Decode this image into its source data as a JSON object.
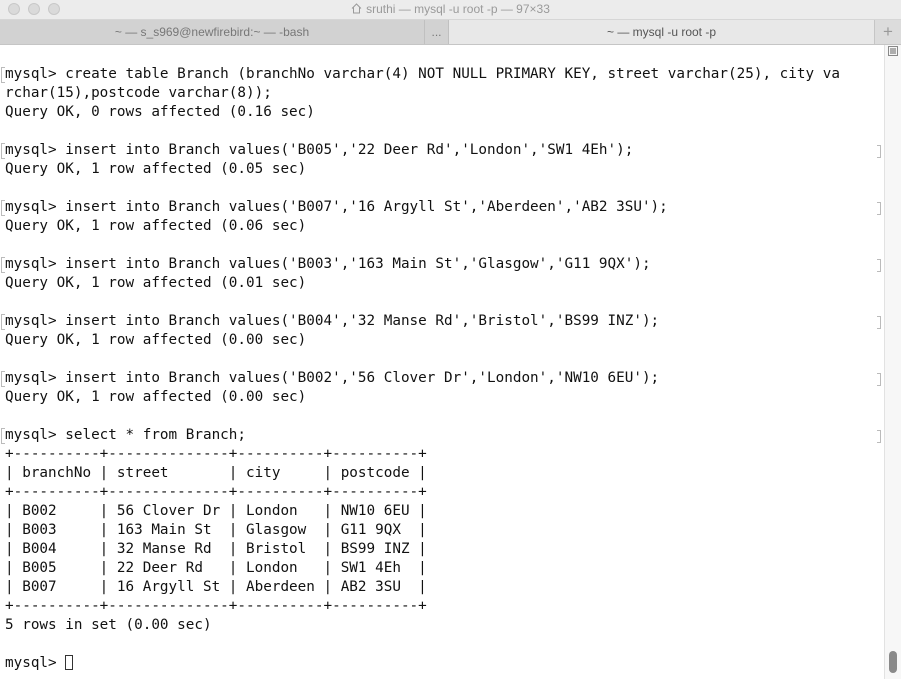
{
  "window": {
    "title": "sruthi — mysql -u root -p — 97×33"
  },
  "tabs": [
    {
      "label": "~ — s_s969@newfirebird:~ — -bash"
    },
    {
      "label": "..."
    },
    {
      "label": "~ — mysql -u root -p"
    }
  ],
  "tab_add_label": "+",
  "terminal": {
    "lines": [
      "mysql> create table Branch (branchNo varchar(4) NOT NULL PRIMARY KEY, street varchar(25), city va",
      "rchar(15),postcode varchar(8));",
      "Query OK, 0 rows affected (0.16 sec)",
      "",
      "mysql> insert into Branch values('B005','22 Deer Rd','London','SW1 4Eh');",
      "Query OK, 1 row affected (0.05 sec)",
      "",
      "mysql> insert into Branch values('B007','16 Argyll St','Aberdeen','AB2 3SU');",
      "Query OK, 1 row affected (0.06 sec)",
      "",
      "mysql> insert into Branch values('B003','163 Main St','Glasgow','G11 9QX');",
      "Query OK, 1 row affected (0.01 sec)",
      "",
      "mysql> insert into Branch values('B004','32 Manse Rd','Bristol','BS99 INZ');",
      "Query OK, 1 row affected (0.00 sec)",
      "",
      "mysql> insert into Branch values('B002','56 Clover Dr','London','NW10 6EU');",
      "Query OK, 1 row affected (0.00 sec)",
      "",
      "mysql> select * from Branch;",
      "+----------+--------------+----------+----------+",
      "| branchNo | street       | city     | postcode |",
      "+----------+--------------+----------+----------+",
      "| B002     | 56 Clover Dr | London   | NW10 6EU |",
      "| B003     | 163 Main St  | Glasgow  | G11 9QX  |",
      "| B004     | 32 Manse Rd  | Bristol  | BS99 INZ |",
      "| B005     | 22 Deer Rd   | London   | SW1 4Eh  |",
      "| B007     | 16 Argyll St | Aberdeen | AB2 3SU  |",
      "+----------+--------------+----------+----------+",
      "5 rows in set (0.00 sec)",
      "",
      "mysql> "
    ]
  }
}
